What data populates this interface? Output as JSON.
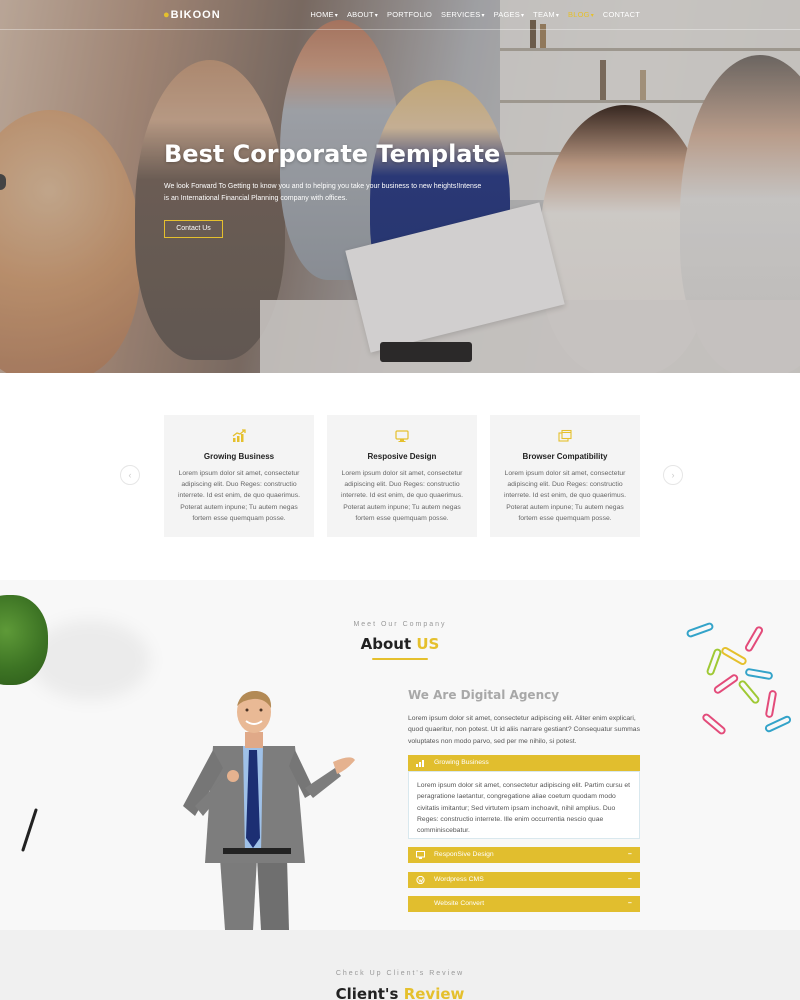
{
  "brand": {
    "logo_text": "BIKOON",
    "accent": "#e5c02d"
  },
  "nav": {
    "items": [
      {
        "label": "HOME",
        "dropdown": true,
        "active": false
      },
      {
        "label": "ABOUT",
        "dropdown": true,
        "active": false
      },
      {
        "label": "PORTFOLIO",
        "dropdown": false,
        "active": false
      },
      {
        "label": "SERVICES",
        "dropdown": true,
        "active": false
      },
      {
        "label": "PAGES",
        "dropdown": true,
        "active": false
      },
      {
        "label": "TEAM",
        "dropdown": true,
        "active": false
      },
      {
        "label": "BLOG",
        "dropdown": true,
        "active": true
      },
      {
        "label": "CONTACT",
        "dropdown": false,
        "active": false
      }
    ]
  },
  "hero": {
    "title": "Best Corporate Template",
    "text": "We look Forward To Getting to know you and to helping you take your business to new heights!Intense is an International Financial Planning company with offices.",
    "button": "Contact Us"
  },
  "features": {
    "cards": [
      {
        "icon": "growth-chart-icon",
        "title": "Growing Business",
        "text": "Lorem ipsum dolor sit amet, consectetur adipiscing elit. Duo Reges: constructio interrete. Id est enim, de quo quaerimus. Poterat autem inpune; Tu autem negas fortem esse quemquam posse."
      },
      {
        "icon": "monitor-icon",
        "title": "Resposive Design",
        "text": "Lorem ipsum dolor sit amet, consectetur adipiscing elit. Duo Reges: constructio interrete. Id est enim, de quo quaerimus. Poterat autem inpune; Tu autem negas fortem esse quemquam posse."
      },
      {
        "icon": "browser-windows-icon",
        "title": "Browser Compatibility",
        "text": "Lorem ipsum dolor sit amet, consectetur adipiscing elit. Duo Reges: constructio interrete. Id est enim, de quo quaerimus. Poterat autem inpune; Tu autem negas fortem esse quemquam posse."
      }
    ],
    "prev_arrow": "‹",
    "next_arrow": "›"
  },
  "about": {
    "kicker": "Meet Our Company",
    "title_main": "About",
    "title_highlight": "US",
    "agency_title": "We Are Digital Agency",
    "agency_text": "Lorem ipsum dolor sit amet, consectetur adipiscing elit. Aliter enim explicari, quod quaeritur, non potest. Ut id aliis narrare gestiant? Consequatur summas voluptates non modo parvo, sed per me nihilo, si potest.",
    "accordion": [
      {
        "label": "Growing Business",
        "icon": "chart-icon",
        "toggle": "−",
        "open": true,
        "body": "Lorem ipsum dolor sit amet, consectetur adipiscing elit. Partim cursu et peragratione laetantur, congregatione aliae coetum quodam modo civitatis imitantur; Sed virtutem ipsam inchoavit, nihil amplius. Duo Reges: constructio interrete. Ille enim occurrentia nescio quae comminiscebatur."
      },
      {
        "label": "ResponSive Design",
        "icon": "monitor-icon",
        "toggle": "−",
        "open": false
      },
      {
        "label": "Wordpress CMS",
        "icon": "wordpress-icon",
        "toggle": "−",
        "open": false
      },
      {
        "label": "Website Convert",
        "icon": "",
        "toggle": "−",
        "open": false
      }
    ]
  },
  "review": {
    "kicker": "Check Up Client's Review",
    "title_main": "Client's",
    "title_highlight": "Review"
  }
}
